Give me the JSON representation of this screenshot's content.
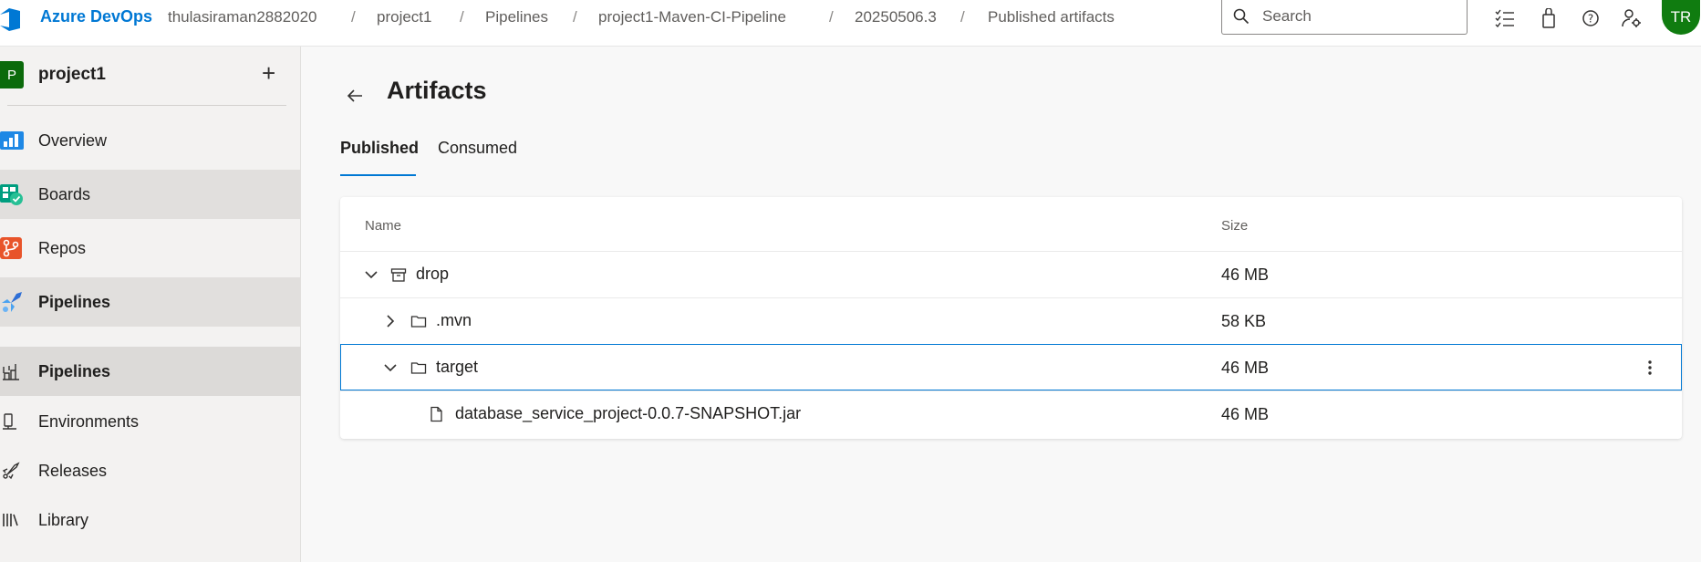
{
  "header": {
    "brand": "Azure DevOps",
    "breadcrumbs": [
      "thulasiraman2882020",
      "project1",
      "Pipelines",
      "project1-Maven-CI-Pipeline",
      "20250506.3",
      "Published artifacts"
    ],
    "search_placeholder": "Search",
    "avatar_initials": "TR",
    "icons": [
      "task-list-icon",
      "shopping-bag-icon",
      "help-icon",
      "user-settings-icon"
    ]
  },
  "sidebar": {
    "project_initial": "P",
    "project_name": "project1",
    "items": [
      {
        "label": "Overview",
        "icon": "overview-icon"
      },
      {
        "label": "Boards",
        "icon": "boards-icon"
      },
      {
        "label": "Repos",
        "icon": "repos-icon"
      },
      {
        "label": "Pipelines",
        "icon": "pipelines-icon"
      },
      {
        "label": "Pipelines",
        "icon": "pipelines-sub-icon"
      },
      {
        "label": "Environments",
        "icon": "environments-icon"
      },
      {
        "label": "Releases",
        "icon": "releases-icon"
      },
      {
        "label": "Library",
        "icon": "library-icon"
      }
    ]
  },
  "main": {
    "title": "Artifacts",
    "tabs": [
      {
        "label": "Published",
        "active": true
      },
      {
        "label": "Consumed",
        "active": false
      }
    ],
    "table": {
      "columns": [
        "Name",
        "Size"
      ],
      "rows": [
        {
          "name": "drop",
          "size": "46 MB",
          "type": "artifact",
          "expanded": true
        },
        {
          "name": ".mvn",
          "size": "58 KB",
          "type": "folder",
          "expanded": false
        },
        {
          "name": "target",
          "size": "46 MB",
          "type": "folder",
          "expanded": true
        },
        {
          "name": "database_service_project-0.0.7-SNAPSHOT.jar",
          "size": "46 MB",
          "type": "file"
        }
      ]
    }
  },
  "colors": {
    "accent": "#0078d4",
    "avatar": "#107c10",
    "project": "#0b6a0b"
  }
}
